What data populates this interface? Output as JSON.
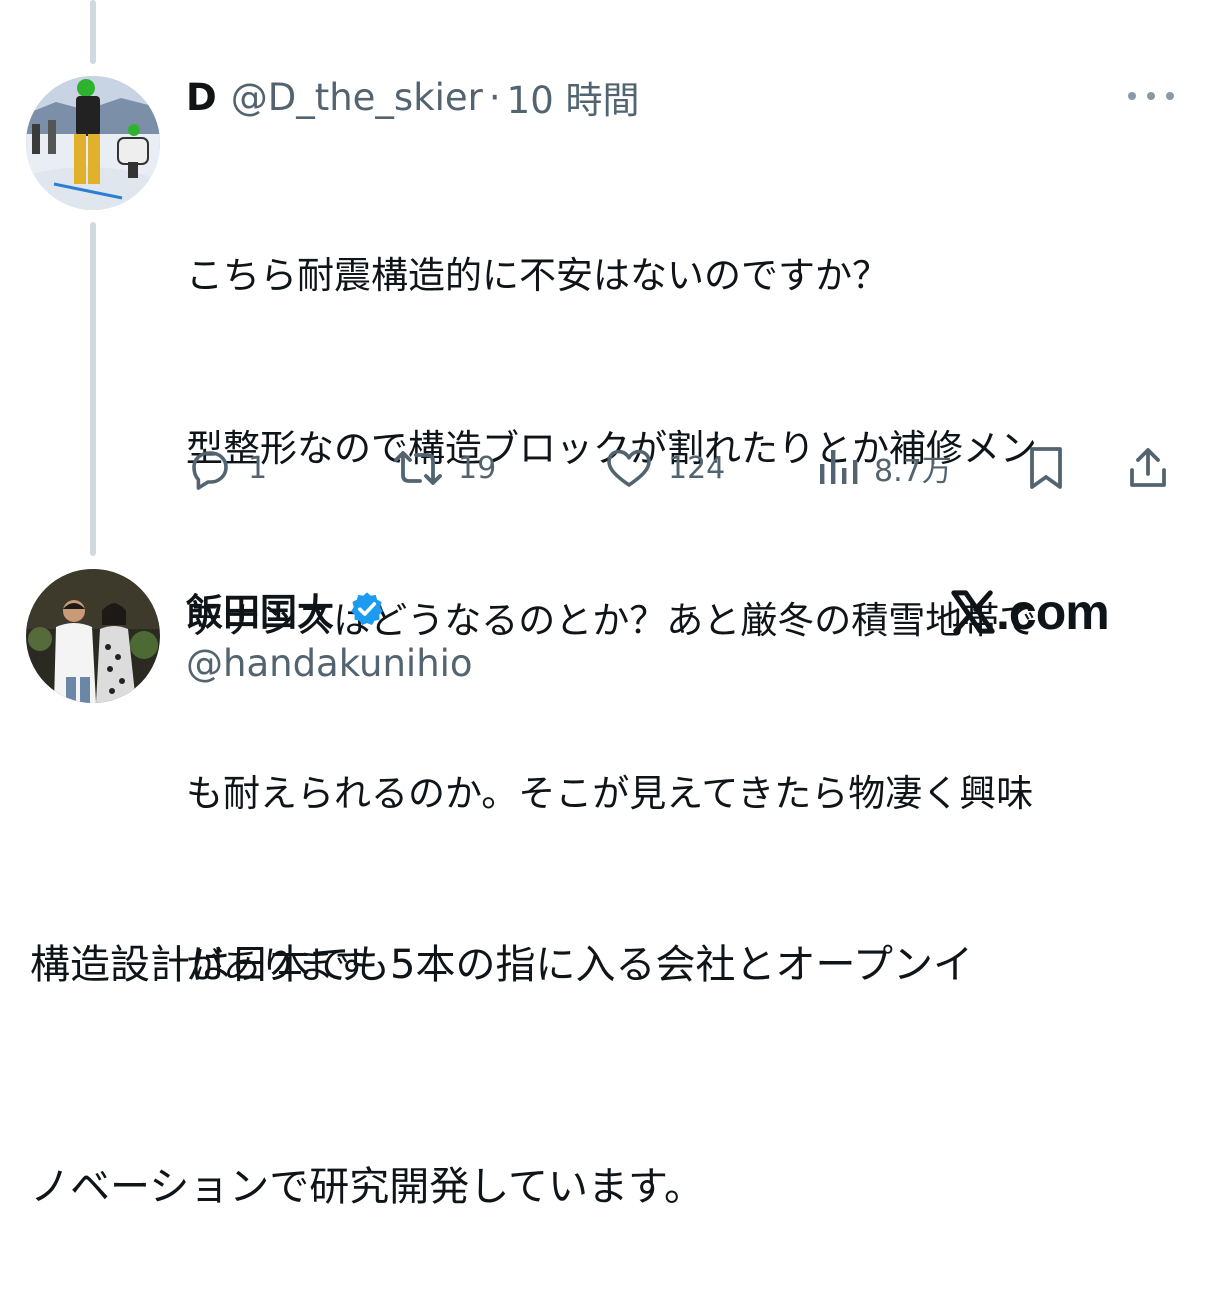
{
  "reply": {
    "name": "D",
    "handle": "@D_the_skier",
    "separator": "·",
    "time": "10 時間",
    "body_lines": [
      "こちら耐震構造的に不安はないのですか？",
      "型整形なので構造ブロックが割れたりとか補修メン",
      "テナンスはどうなるのとか？あと厳冬の積雪地帯で",
      "も耐えられるのか。そこが見えてきたら物凄く興味",
      "があります"
    ],
    "actions": {
      "replies": "1",
      "reposts": "19",
      "likes": "124",
      "views": "8.7万"
    },
    "icons": [
      "reply-icon",
      "repost-icon",
      "like-icon",
      "views-icon",
      "bookmark-icon",
      "share-icon",
      "more-icon"
    ]
  },
  "post": {
    "name": "飯田国大",
    "handle": "@handakunihio",
    "verified": true,
    "brand": "X.com",
    "brand_x": "X",
    "brand_rest": ".com",
    "body_lines": [
      "構造設計は日本でも5本の指に入る会社とオープンイ",
      "ノベーションで研究開発しています。"
    ]
  },
  "colors": {
    "text": "#0f1419",
    "secondary": "#536471",
    "thread_line": "#cfd9de",
    "verified": "#1d9bf0"
  }
}
